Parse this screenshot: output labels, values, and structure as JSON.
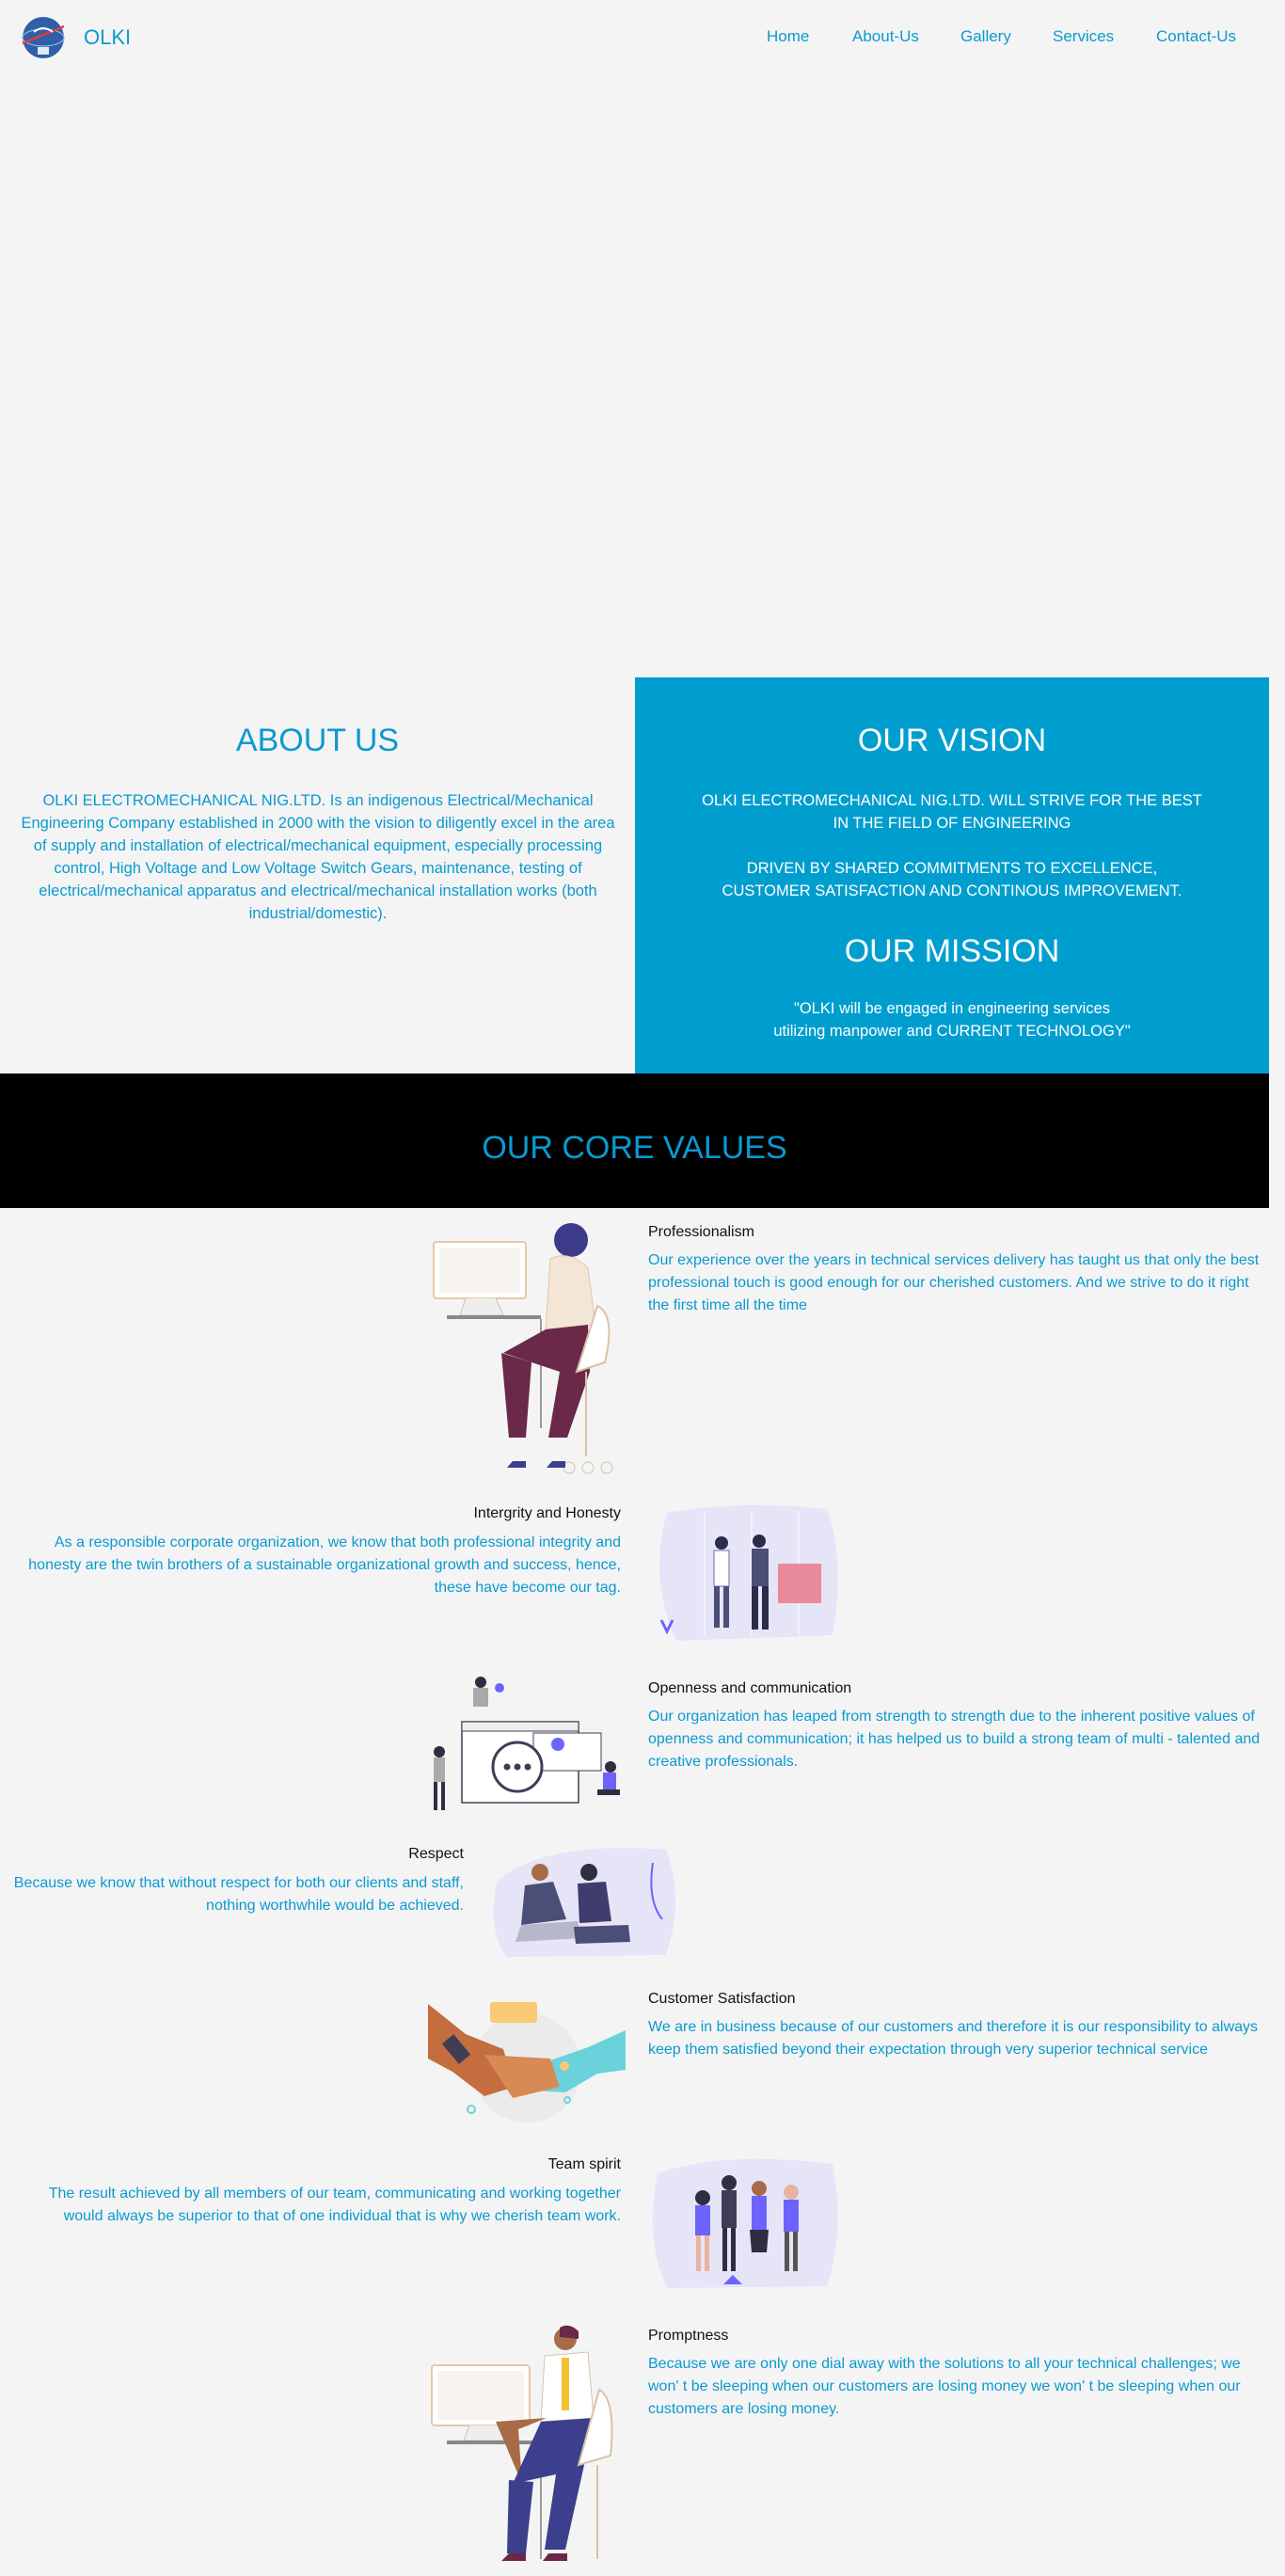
{
  "header": {
    "brand": "OLKI",
    "logo_icon": "olki-globe-logo",
    "nav": [
      "Home",
      "About-Us",
      "Gallery",
      "Services",
      "Contact-Us"
    ]
  },
  "about": {
    "title": "ABOUT US",
    "text": "OLKI ELECTROMECHANICAL NIG.LTD. Is an indigenous Electrical/Mechanical Engineering Company established in 2000 with the vision to diligently excel in the area of supply and installation of electrical/mechanical equipment, especially processing control, High Voltage and Low Voltage Switch Gears, maintenance, testing of electrical/mechanical apparatus and electrical/mechanical installation works (both industrial/domestic)."
  },
  "vision": {
    "title": "OUR VISION",
    "line1": "OLKI ELECTROMECHANICAL NIG.LTD. WILL STRIVE FOR THE BEST",
    "line2": "IN THE FIELD OF ENGINEERING",
    "line3": "DRIVEN BY SHARED COMMITMENTS TO EXCELLENCE,",
    "line4": "CUSTOMER SATISFACTION AND CONTINOUS IMPROVEMENT."
  },
  "mission": {
    "title": "OUR MISSION",
    "line1": "\"OLKI will be engaged in engineering services",
    "line2": "utilizing manpower and CURRENT TECHNOLOGY\""
  },
  "core": {
    "title": "OUR CORE VALUES",
    "values": [
      {
        "title": "Professionalism",
        "text": "Our experience over the years in technical services delivery has taught us that only the best professional touch is good enough for our cherished customers. And we strive to do it right the first time all the time",
        "icon": "woman-at-desk-illustration"
      },
      {
        "title": "Intergrity and Honesty",
        "text": "As a responsible corporate organization, we know that both professional integrity and honesty are the twin brothers of a sustainable organizational growth and success, hence, these have become our tag.",
        "icon": "handshake-office-illustration"
      },
      {
        "title": "Openness and communication",
        "text": "Our organization has leaped from strength to strength due to the inherent positive values of openness and communication; it has helped us to build a strong team of multi - talented and creative professionals.",
        "icon": "chat-communication-illustration"
      },
      {
        "title": "Respect",
        "text": "Because we know that without respect for both our clients and staff, nothing worthwhile would be achieved.",
        "icon": "two-people-sitting-illustration"
      },
      {
        "title": "Customer Satisfaction",
        "text": "We are in business because of our customers and therefore it is our responsibility to always keep them satisfied beyond their expectation through very superior technical service",
        "icon": "handshake-hands-illustration"
      },
      {
        "title": "Team spirit",
        "text": "The result achieved by all members of our team, communicating and working together would always be superior to that of one individual that is why we cherish team work.",
        "icon": "team-group-illustration"
      },
      {
        "title": "Promptness",
        "text": "Because we are only one dial away with the solutions to all your technical challenges; we won' t be sleeping when our customers are losing money we won' t be sleeping when our customers are losing money.",
        "icon": "man-at-desk-illustration"
      }
    ]
  },
  "colors": {
    "accent": "#0a9ad0",
    "vision_bg": "#009ecf",
    "core_bg": "#000000",
    "page_bg": "#f4f4f4"
  }
}
